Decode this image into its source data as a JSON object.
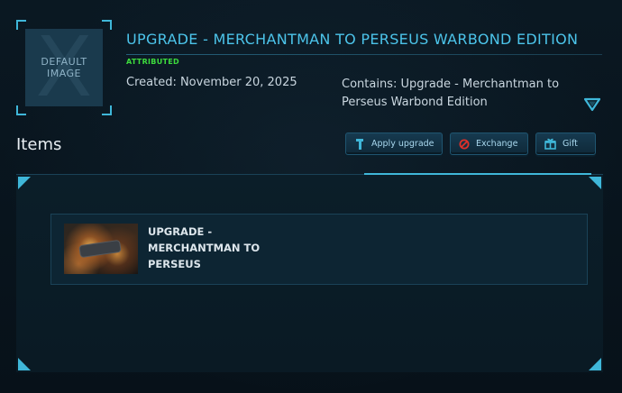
{
  "pledge": {
    "thumbnail_label": "DEFAULT IMAGE",
    "thumbnail_watermark": "X",
    "title": "UPGRADE - MERCHANTMAN TO PERSEUS WARBOND EDITION",
    "status": "ATTRIBUTED",
    "created": "Created: November 20, 2025",
    "contains": "Contains: Upgrade - Merchantman to Perseus Warbond Edition",
    "expand_icon": "triangle-down-icon"
  },
  "items_section": {
    "heading": "Items",
    "buttons": [
      {
        "label": "Apply upgrade",
        "icon": "upgrade-icon"
      },
      {
        "label": "Exchange",
        "icon": "exchange-icon"
      },
      {
        "label": "Gift",
        "icon": "gift-icon"
      }
    ],
    "items": [
      {
        "name": "UPGRADE - MERCHANTMAN TO PERSEUS"
      }
    ]
  },
  "colors": {
    "accent": "#3fb7d9",
    "title": "#4cc4ea",
    "status_green": "#3ddc3d",
    "background": "#08141d",
    "exchange_red": "#e0302a"
  }
}
